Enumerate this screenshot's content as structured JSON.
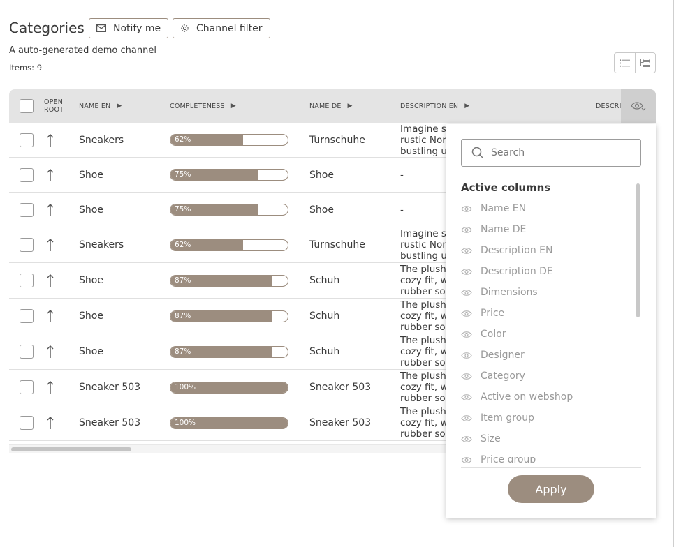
{
  "header": {
    "title": "Categories",
    "notify_label": "Notify me",
    "channel_filter_label": "Channel filter",
    "subtitle": "A auto-generated demo channel",
    "items_count": "Items: 9"
  },
  "table": {
    "columns": {
      "open_root": "OPEN ROOT",
      "name_en": "NAME EN",
      "completeness": "COMPLETENESS",
      "name_de": "NAME DE",
      "description_en": "DESCRIPTION EN",
      "description_de": "DESCRI"
    },
    "rows": [
      {
        "name_en": "Sneakers",
        "completeness": 62,
        "completeness_label": "62%",
        "name_de": "Turnschuhe",
        "desc": [
          "Imagine st",
          "rustic Nor",
          "bustling ur"
        ]
      },
      {
        "name_en": "Shoe",
        "completeness": 75,
        "completeness_label": "75%",
        "name_de": "Shoe",
        "desc": [
          "-"
        ]
      },
      {
        "name_en": "Shoe",
        "completeness": 75,
        "completeness_label": "75%",
        "name_de": "Shoe",
        "desc": [
          "-"
        ]
      },
      {
        "name_en": "Sneakers",
        "completeness": 62,
        "completeness_label": "62%",
        "name_de": "Turnschuhe",
        "desc": [
          "Imagine st",
          "rustic Nor",
          "bustling ur"
        ]
      },
      {
        "name_en": "Shoe",
        "completeness": 87,
        "completeness_label": "87%",
        "name_de": "Schuh",
        "desc": [
          "The plush",
          "cozy fit, wh",
          "rubber sol"
        ]
      },
      {
        "name_en": "Shoe",
        "completeness": 87,
        "completeness_label": "87%",
        "name_de": "Schuh",
        "desc": [
          "The plush",
          "cozy fit, wh",
          "rubber sol"
        ]
      },
      {
        "name_en": "Shoe",
        "completeness": 87,
        "completeness_label": "87%",
        "name_de": "Schuh",
        "desc": [
          "The plush",
          "cozy fit, wh",
          "rubber sol"
        ]
      },
      {
        "name_en": "Sneaker 503",
        "completeness": 100,
        "completeness_label": "100%",
        "name_de": "Sneaker 503",
        "desc": [
          "The plush",
          "cozy fit, wh",
          "rubber sol"
        ]
      },
      {
        "name_en": "Sneaker 503",
        "completeness": 100,
        "completeness_label": "100%",
        "name_de": "Sneaker 503",
        "desc": [
          "The plush",
          "cozy fit, wh",
          "rubber sol"
        ]
      }
    ]
  },
  "column_panel": {
    "search_placeholder": "Search",
    "heading": "Active columns",
    "items": [
      "Name EN",
      "Name DE",
      "Description EN",
      "Description DE",
      "Dimensions",
      "Price",
      "Color",
      "Designer",
      "Category",
      "Active on webshop",
      "Item group",
      "Size",
      "Price group"
    ],
    "apply_label": "Apply"
  },
  "colors": {
    "accent": "#9c8d7f",
    "header_bg": "#e4e4e4"
  },
  "icons": {
    "notify": "envelope-icon",
    "channel_filter": "gear-icon",
    "list_view": "list-icon",
    "tree_view": "tree-icon",
    "column_visibility": "eye-icon",
    "open_root": "arrow-up-icon",
    "search": "search-icon"
  }
}
